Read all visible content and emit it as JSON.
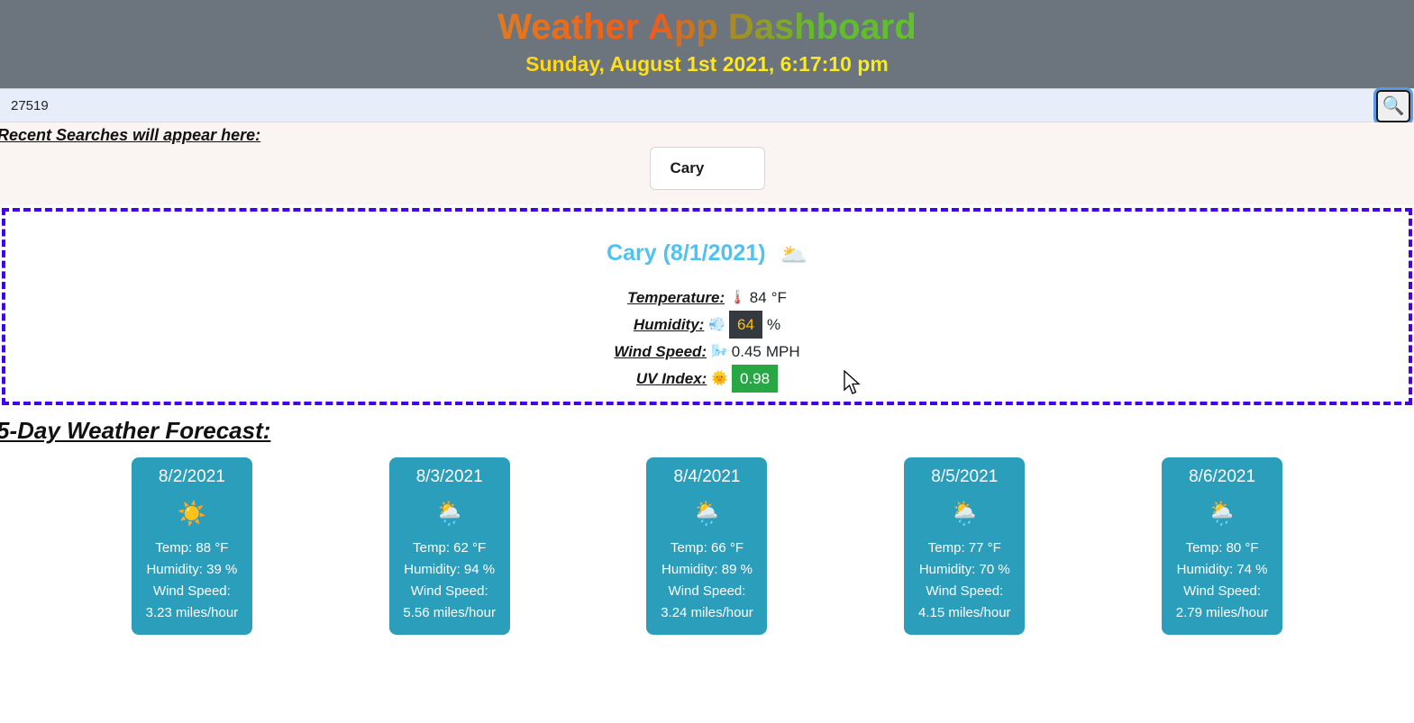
{
  "header": {
    "title": "Weather App Dashboard",
    "datetime": "Sunday, August 1st 2021, 6:17:10 pm",
    "bg_color": "#6c757d"
  },
  "search": {
    "value": "27519",
    "placeholder": "",
    "button_icon": "search-icon",
    "button_glyph": "🔍"
  },
  "recent": {
    "label": "Recent Searches will appear here:",
    "items": [
      {
        "label": "Cary"
      }
    ]
  },
  "current": {
    "city_date": "Cary (8/1/2021)",
    "city_color": "#4fc3f0",
    "condition_icon": "cloud-icon",
    "condition_glyph": "🌥️",
    "border_color": "#4400ee",
    "metrics": [
      {
        "label": "Temperature:",
        "icon": "thermometer-icon",
        "glyph": "🌡️",
        "value": "84",
        "unit": "°F",
        "badge": "none"
      },
      {
        "label": "Humidity:",
        "icon": "droplet-icon",
        "glyph": "💨",
        "value": "64",
        "unit": "%",
        "badge": "dark",
        "badge_bg": "#343a40",
        "badge_fg": "#ffc107"
      },
      {
        "label": "Wind Speed:",
        "icon": "wind-icon",
        "glyph": "🌬️",
        "value": "0.45",
        "unit": "MPH",
        "badge": "none"
      },
      {
        "label": "UV Index:",
        "icon": "uv-sun-icon",
        "glyph": "🌞",
        "value": "0.98",
        "unit": "",
        "badge": "green",
        "badge_bg": "#28a745",
        "badge_fg": "#ffffff"
      }
    ]
  },
  "forecast": {
    "title": "5-Day Weather Forecast:",
    "card_bg": "#2b9ebc",
    "cards": [
      {
        "date": "8/2/2021",
        "icon": "sun-icon",
        "glyph": "☀️",
        "temp": "Temp: 88 °F",
        "humidity": "Humidity: 39 %",
        "wind": "Wind Speed: 3.23 miles/hour"
      },
      {
        "date": "8/3/2021",
        "icon": "sun-behind-rain-cloud-icon",
        "glyph": "🌦️",
        "temp": "Temp: 62 °F",
        "humidity": "Humidity: 94 %",
        "wind": "Wind Speed: 5.56 miles/hour"
      },
      {
        "date": "8/4/2021",
        "icon": "sun-behind-rain-cloud-icon",
        "glyph": "🌦️",
        "temp": "Temp: 66 °F",
        "humidity": "Humidity: 89 %",
        "wind": "Wind Speed: 3.24 miles/hour"
      },
      {
        "date": "8/5/2021",
        "icon": "sun-behind-rain-cloud-icon",
        "glyph": "🌦️",
        "temp": "Temp: 77 °F",
        "humidity": "Humidity: 70 %",
        "wind": "Wind Speed: 4.15 miles/hour"
      },
      {
        "date": "8/6/2021",
        "icon": "sun-behind-rain-cloud-icon",
        "glyph": "🌦️",
        "temp": "Temp: 80 °F",
        "humidity": "Humidity: 74 %",
        "wind": "Wind Speed: 2.79 miles/hour"
      }
    ]
  }
}
